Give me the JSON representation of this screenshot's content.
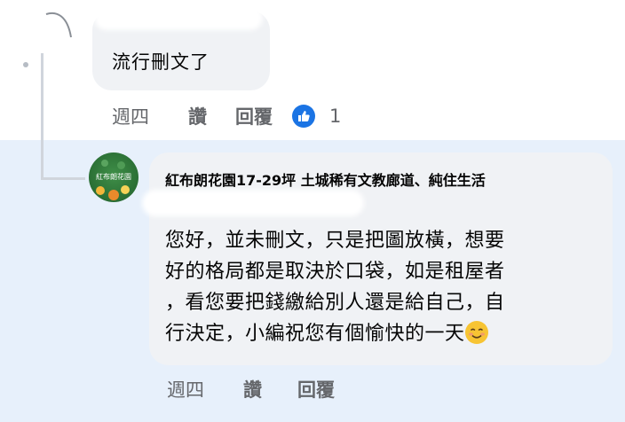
{
  "comment1": {
    "text": "流行刪文了",
    "time": "週四",
    "like_label": "讚",
    "reply_label": "回覆",
    "reaction_count": "1"
  },
  "comment2": {
    "author": "紅布朗花園17-29坪 土城稀有文教廊道、純住生活",
    "avatar_text": "紅布朗花園",
    "lines": [
      "您好，並未刪文，只是把圖放橫，想要",
      "好的格局都是取決於口袋，如是租屋者",
      "，看您要把錢繳給別人還是給自己，自",
      "行決定，小編祝您有個愉快的一天"
    ],
    "time": "週四",
    "like_label": "讚",
    "reply_label": "回覆"
  },
  "colors": {
    "highlight_bg": "#e7f0fb",
    "bubble_bg": "#f0f2f5",
    "like_blue": "#1b74e4",
    "muted": "#65676b"
  },
  "icons": [
    "thumbs-up-icon",
    "smiling-face-emoji"
  ]
}
